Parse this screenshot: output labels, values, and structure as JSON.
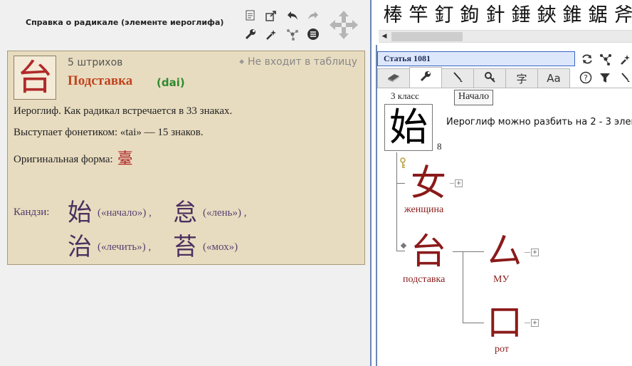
{
  "left": {
    "title": "Справка о радикале  (элементе иероглифа)",
    "toolbar_icons": [
      "notes-icon",
      "export-icon",
      "back-icon",
      "forward-icon",
      "move-icon",
      "wrench-icon",
      "magic-wand-icon",
      "graph-icon",
      "list-icon"
    ],
    "radical": {
      "char": "台",
      "strokes": "5  штрихов",
      "name": "Подставка",
      "pinyin": "(dai)",
      "not_in_table": "Не входит в таблицу",
      "line1": "Иероглиф. Как радикал встречается в 33 знаках.",
      "line2": "Выступает фонетиком: «tai» — 15 знаков.",
      "line3_label": "Оригинальная форма:",
      "original_form": "臺",
      "kanji_label": "Кандзи:",
      "kanji": [
        {
          "char": "始",
          "gloss": "(«начало») ,"
        },
        {
          "char": "怠",
          "gloss": "(«лень») ,"
        },
        {
          "char": "治",
          "gloss": "(«лечить») ,"
        },
        {
          "char": "苔",
          "gloss": "(«мох»)"
        }
      ]
    }
  },
  "right": {
    "strip": [
      "棒",
      "竿",
      "釘",
      "鉤",
      "針",
      "錘",
      "鋏",
      "錐",
      "鋸",
      "斧"
    ],
    "article": "Статья 1081",
    "tabs": [
      {
        "name": "book-icon"
      },
      {
        "name": "wrench-icon",
        "active": true
      },
      {
        "name": "brush-icon"
      },
      {
        "name": "key-search-icon"
      },
      {
        "name": "character-icon",
        "text": "字"
      },
      {
        "name": "font-icon",
        "text": "Aa"
      }
    ],
    "tooltip": "Начало",
    "grade": "3 класс",
    "main_kanji": "始",
    "main_strokes": "8",
    "split_text": "Иероглиф можно разбить на  2 - 3  элем",
    "components": [
      {
        "char": "女",
        "label": "женщина"
      },
      {
        "char": "台",
        "label": "подставка"
      },
      {
        "char": "厶",
        "label": "МУ"
      },
      {
        "char": "口",
        "label": "рот"
      }
    ]
  }
}
